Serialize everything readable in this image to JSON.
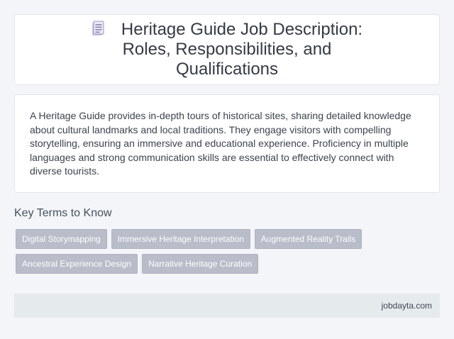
{
  "header": {
    "icon": "document-icon",
    "title": "Heritage Guide Job Description: Roles, Responsibilities, and Qualifications"
  },
  "description": {
    "text": "A Heritage Guide provides in-depth tours of historical sites, sharing detailed knowledge about cultural landmarks and local traditions. They engage visitors with compelling storytelling, ensuring an immersive and educational experience. Proficiency in multiple languages and strong communication skills are essential to effectively connect with diverse tourists."
  },
  "key_terms": {
    "heading": "Key Terms to Know",
    "items": [
      "Digital Storymapping",
      "Immersive Heritage Interpretation",
      "Augmented Reality Trails",
      "Ancestral Experience Design",
      "Narrative Heritage Curation"
    ]
  },
  "footer": {
    "source": "jobdayta.com"
  },
  "colors": {
    "background": "#f3f5f8",
    "card": "#ffffff",
    "tag": "#b9bcc9",
    "footer": "#e5eaec"
  }
}
